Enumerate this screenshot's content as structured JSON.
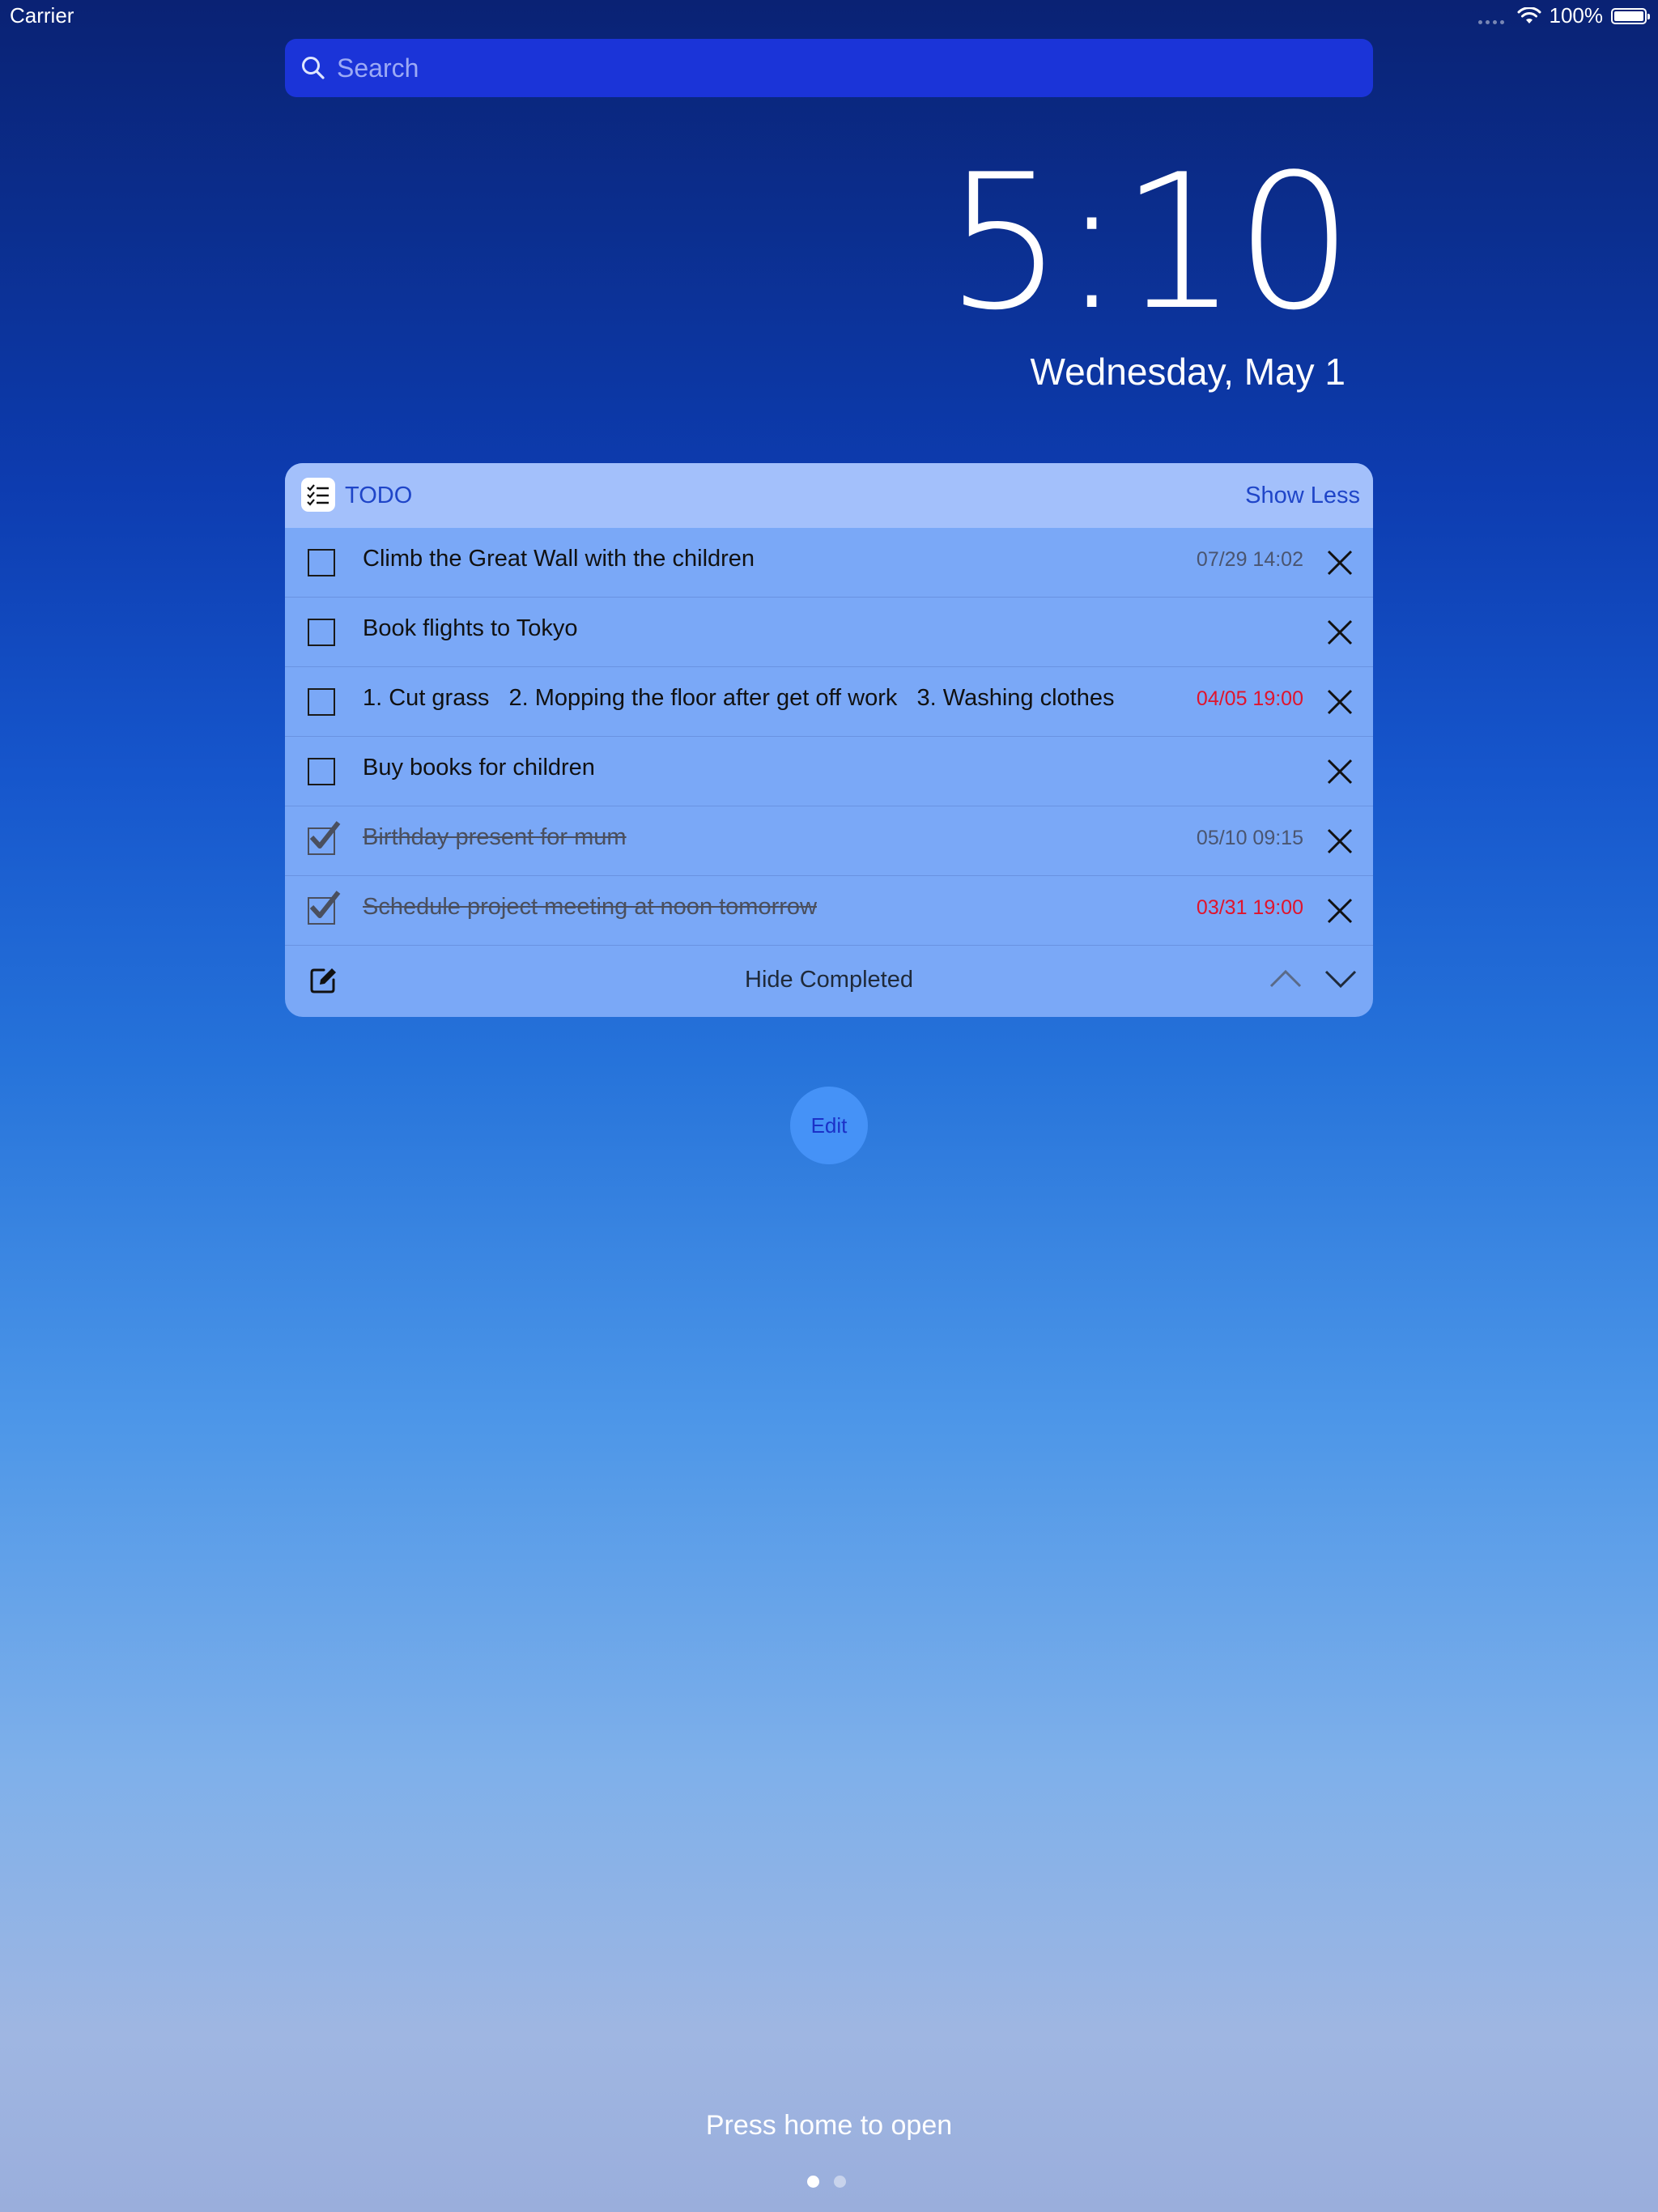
{
  "status_bar": {
    "carrier": "Carrier",
    "battery_text": "100%",
    "icons": [
      "signal-dots-icon",
      "wifi-icon",
      "battery-icon"
    ]
  },
  "search": {
    "placeholder": "Search",
    "icon": "search-icon"
  },
  "lock_screen": {
    "time": "5:10",
    "date": "Wednesday, May 1"
  },
  "widget": {
    "app_name": "TODO",
    "app_icon": "checklist-icon",
    "show_less_label": "Show Less",
    "items": [
      {
        "text": "Climb the Great Wall with the children",
        "due": "07/29 14:02",
        "overdue": false,
        "completed": false
      },
      {
        "text": "Book flights to Tokyo",
        "due": "",
        "overdue": false,
        "completed": false
      },
      {
        "text": "1. Cut grass   2. Mopping the floor after get off work   3. Washing clothes",
        "due": "04/05 19:00",
        "overdue": true,
        "completed": false
      },
      {
        "text": "Buy books for children",
        "due": "",
        "overdue": false,
        "completed": false
      },
      {
        "text": "Birthday present for mum",
        "due": "05/10 09:15",
        "overdue": false,
        "completed": true
      },
      {
        "text": "Schedule project meeting at noon tomorrow",
        "due": "03/31 19:00",
        "overdue": true,
        "completed": true
      }
    ],
    "footer": {
      "hide_completed_label": "Hide Completed",
      "icons": [
        "compose-icon",
        "chevron-up-icon",
        "chevron-down-icon"
      ]
    }
  },
  "edit_button_label": "Edit",
  "bottom": {
    "press_home_text": "Press home to open",
    "page_count": 2,
    "current_page": 1
  },
  "colors": {
    "accent": "#1f45c8",
    "overdue": "#e0142c",
    "widget_body": "#7aa8f7",
    "widget_header": "#a3c0fb",
    "edit_button": "#4592f7"
  }
}
